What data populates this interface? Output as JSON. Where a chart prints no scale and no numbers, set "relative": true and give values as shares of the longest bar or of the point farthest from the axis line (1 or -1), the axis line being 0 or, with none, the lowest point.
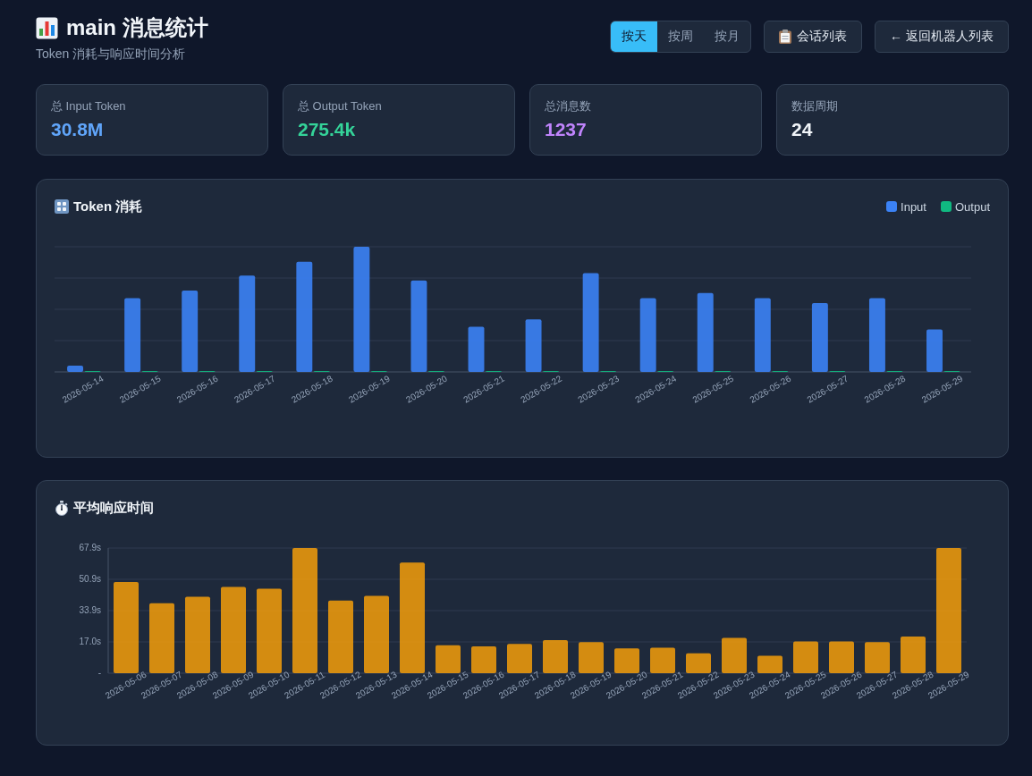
{
  "header": {
    "title": "main 消息统计",
    "subtitle": "Token 消耗与响应时间分析",
    "periods": [
      {
        "label": "按天",
        "selected": true
      },
      {
        "label": "按周",
        "selected": false
      },
      {
        "label": "按月",
        "selected": false
      }
    ],
    "session_button": {
      "label": "会话列表"
    },
    "back_button": {
      "label": "← 返回机器人列表"
    }
  },
  "stats": [
    {
      "label": "总 Input Token",
      "value": "30.8M",
      "color": "#60a5fa"
    },
    {
      "label": "总 Output Token",
      "value": "275.4k",
      "color": "#34d399"
    },
    {
      "label": "总消息数",
      "value": "1237",
      "color": "#c084fc"
    },
    {
      "label": "数据周期",
      "value": "24",
      "color": "#f1f5f9"
    }
  ],
  "token_chart": {
    "chart_data": {
      "type": "bar",
      "title": "Token 消耗",
      "relative": true,
      "grid": true,
      "categories": [
        "2026-05-14",
        "2026-05-15",
        "2026-05-16",
        "2026-05-17",
        "2026-05-18",
        "2026-05-19",
        "2026-05-20",
        "2026-05-21",
        "2026-05-22",
        "2026-05-23",
        "2026-05-24",
        "2026-05-25",
        "2026-05-26",
        "2026-05-27",
        "2026-05-28",
        "2026-05-29"
      ],
      "series": [
        {
          "name": "Input",
          "color": "#3b82f6",
          "values": [
            0.05,
            0.59,
            0.65,
            0.77,
            0.88,
            1,
            0.73,
            0.36,
            0.42,
            0.79,
            0.59,
            0.63,
            0.59,
            0.55,
            0.59,
            0.34
          ]
        },
        {
          "name": "Output",
          "color": "#10b981",
          "values": [
            0.005,
            0.005,
            0.005,
            0.005,
            0.005,
            0.005,
            0.005,
            0.005,
            0.005,
            0.005,
            0.005,
            0.005,
            0.005,
            0.005,
            0.005,
            0.005
          ]
        }
      ]
    }
  },
  "response_chart": {
    "chart_data": {
      "type": "bar",
      "title": "平均响应时间",
      "grid": true,
      "categories": [
        "2026-05-06",
        "2026-05-07",
        "2026-05-08",
        "2026-05-09",
        "2026-05-10",
        "2026-05-11",
        "2026-05-12",
        "2026-05-13",
        "2026-05-14",
        "2026-05-15",
        "2026-05-16",
        "2026-05-17",
        "2026-05-18",
        "2026-05-19",
        "2026-05-20",
        "2026-05-21",
        "2026-05-22",
        "2026-05-23",
        "2026-05-24",
        "2026-05-25",
        "2026-05-26",
        "2026-05-27",
        "2026-05-28",
        "2026-05-29"
      ],
      "values": [
        49.5,
        37.9,
        41.5,
        46.8,
        45.8,
        67.9,
        39.4,
        41.9,
        60,
        15.2,
        14.5,
        15.9,
        17.9,
        16.9,
        13.5,
        13.8,
        10.8,
        19.2,
        9.5,
        17.2,
        17.2,
        16.9,
        19.9,
        67.9
      ],
      "ylim": [
        0,
        67.9
      ],
      "yticks": [
        {
          "value": 0,
          "label": "-"
        },
        {
          "value": 16.975,
          "label": "17.0s"
        },
        {
          "value": 33.95,
          "label": "33.9s"
        },
        {
          "value": 50.925,
          "label": "50.9s"
        },
        {
          "value": 67.9,
          "label": "67.9s"
        }
      ]
    }
  }
}
